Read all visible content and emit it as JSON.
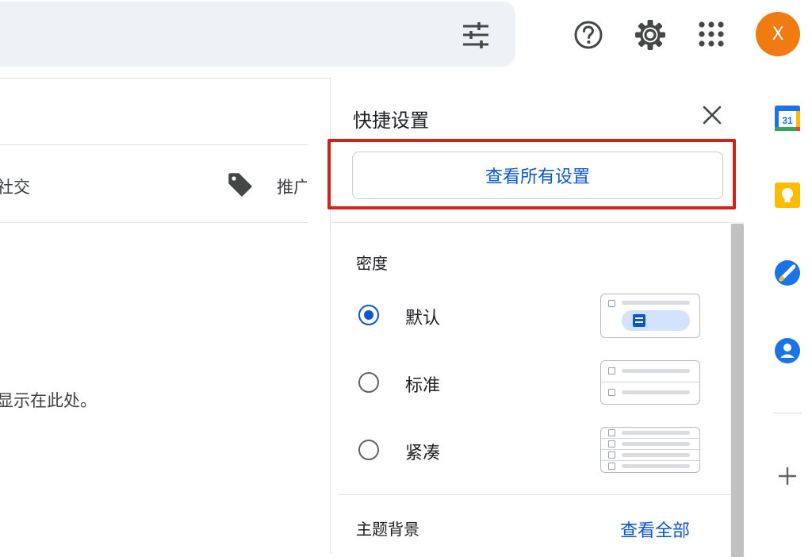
{
  "header": {
    "filter_icon": "tune-icon",
    "help_icon": "help-icon",
    "settings_icon": "gear-icon",
    "apps_icon": "apps-grid-icon",
    "avatar_letter": "X",
    "avatar_color": "#f07b10"
  },
  "left": {
    "tab_social": "社交",
    "tab_promotions": "推广",
    "empty_message": "显示在此处。"
  },
  "quick_settings": {
    "title": "快捷设置",
    "view_all_button": "查看所有设置",
    "density": {
      "label": "密度",
      "options": [
        {
          "label": "默认",
          "selected": true
        },
        {
          "label": "标准",
          "selected": false
        },
        {
          "label": "紧凑",
          "selected": false
        }
      ]
    },
    "theme": {
      "label": "主题背景",
      "view_all_link": "查看全部"
    },
    "highlight_color": "#d32218"
  },
  "side_apps": {
    "calendar_day": "31",
    "items": [
      "calendar-icon",
      "keep-icon",
      "tasks-icon",
      "contacts-icon",
      "add-icon"
    ]
  },
  "colors": {
    "accent_blue": "#0b57d0",
    "search_bg": "#eef2f6"
  }
}
